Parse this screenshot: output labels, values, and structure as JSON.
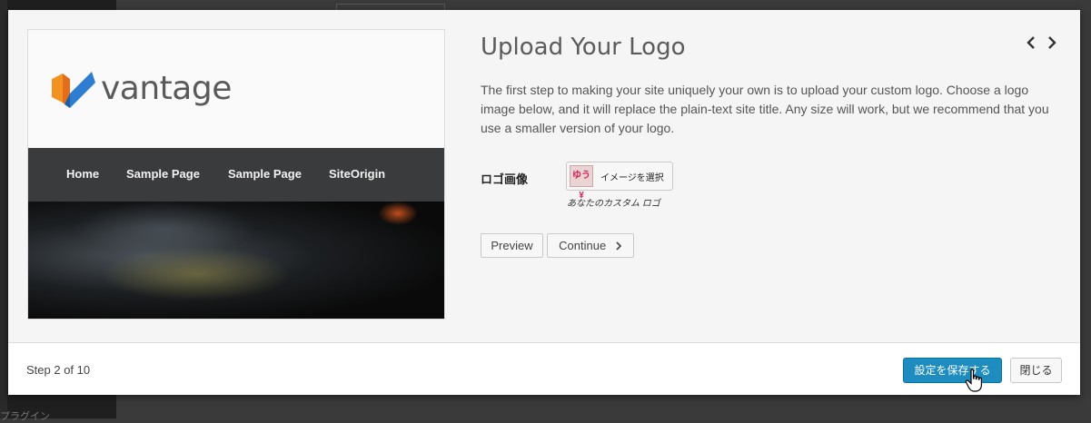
{
  "background": {
    "sidebar_text": "プラグイン"
  },
  "preview": {
    "logo_text": "vantage",
    "nav": [
      "Home",
      "Sample Page",
      "Sample Page",
      "SiteOrigin"
    ]
  },
  "content": {
    "title": "Upload Your Logo",
    "description": "The first step to making your site uniquely your own is to upload your custom logo. Choose a logo image below, and it will replace the plain-text site title. Any size will work, but we recommend that you use a smaller version of your logo.",
    "logo_field_label": "ロゴ画像",
    "thumbnail_text": "ゆう¥",
    "select_image_label": "イメージを選択",
    "caption": "あなたのカスタム ロゴ",
    "preview_button": "Preview",
    "continue_button": "Continue"
  },
  "footer": {
    "step": "Step 2 of 10",
    "save_button": "設定を保存する",
    "close_button": "閉じる"
  },
  "colors": {
    "primary": "#1e8cbe",
    "nav_bg": "#3a3b3c",
    "logo_orange": "#f39221",
    "logo_blue": "#2e7dd1"
  }
}
